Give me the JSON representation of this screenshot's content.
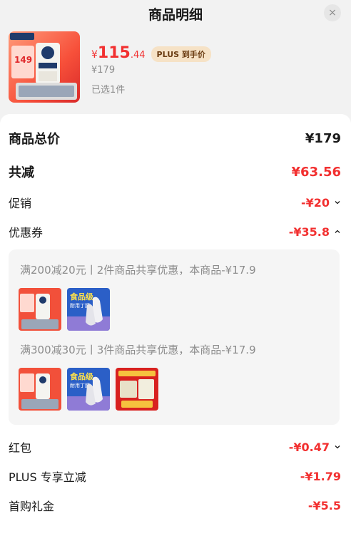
{
  "header": {
    "title": "商品明细",
    "close": "×"
  },
  "product": {
    "price_symbol": "¥",
    "price_int": "115",
    "price_dec": ".44",
    "plus_badge": "PLUS 到手价",
    "original_price": "¥179",
    "selected": "已选1件"
  },
  "breakdown": {
    "total_label": "商品总价",
    "total_value": "¥179",
    "reduce_label": "共减",
    "reduce_value": "¥63.56",
    "promo_label": "促销",
    "promo_value": "-¥20",
    "coupon_label": "优惠券",
    "coupon_value": "-¥35.8",
    "redpack_label": "红包",
    "redpack_value": "-¥0.47",
    "plus_label": "PLUS 专享立减",
    "plus_value": "-¥1.79",
    "firstbuy_label": "首购礼金",
    "firstbuy_value": "-¥5.5"
  },
  "coupons": [
    {
      "text": "满200减20元丨2件商品共享优惠，本商品-¥17.9"
    },
    {
      "text": "满300减30元丨3件商品共享优惠，本商品-¥17.9"
    }
  ],
  "thumb_text": {
    "glove_line1": "食品级",
    "glove_line2": "耐用丁腈",
    "beer_price": "149"
  },
  "colors": {
    "accent": "#f23030",
    "muted": "#8c8c8c",
    "plus_bg": "#f6e2c6"
  }
}
